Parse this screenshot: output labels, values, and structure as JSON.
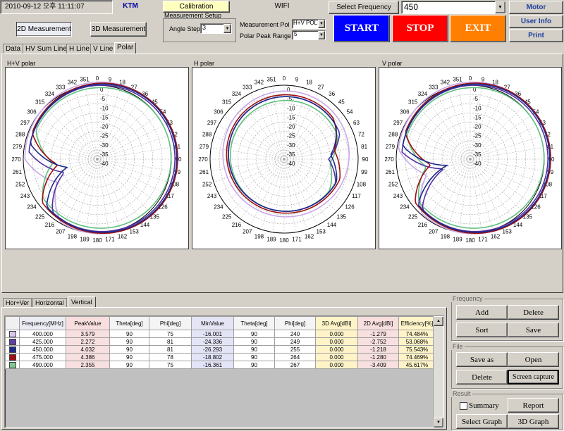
{
  "header": {
    "datetime": "2010-09-12 오후 11:11:07",
    "brand": "KTM",
    "calibration_label": "Calibration",
    "wifi_label": "WIFI",
    "select_frequency_label": "Select Frequency",
    "select_frequency_value": "450",
    "motor_label": "Motor",
    "user_info_label": "User Info",
    "print_label": "Print",
    "mode_2d_label": "2D Measurement",
    "mode_3d_label": "3D Measurement",
    "measurement_setup_label": "Measurement  Setup",
    "angle_step_label": "Angle Step",
    "angle_step_value": "3",
    "measurement_pol_label": "Measurement Pol",
    "measurement_pol_value": "H+V POL",
    "polar_peak_range_label": "Polar Peak Range",
    "polar_peak_range_value": "5",
    "start_label": "START",
    "stop_label": "STOP",
    "exit_label": "EXIT",
    "start_color": "#0000ff",
    "stop_color": "#ff0000",
    "exit_color": "#ff8000"
  },
  "tabs": [
    "Data",
    "HV Sum Line",
    "H Line",
    "V Line",
    "Polar"
  ],
  "active_tab": "Polar",
  "polar": {
    "plots": [
      {
        "title": "H+V polar"
      },
      {
        "title": "H polar"
      },
      {
        "title": "V polar"
      }
    ],
    "angle_labels": [
      "0",
      "9",
      "18",
      "27",
      "36",
      "45",
      "54",
      "63",
      "72",
      "81",
      "90",
      "99",
      "108",
      "117",
      "126",
      "135",
      "144",
      "153",
      "162",
      "171",
      "180",
      "189",
      "198",
      "207",
      "216",
      "225",
      "234",
      "243",
      "252",
      "261",
      "270",
      "279",
      "288",
      "297",
      "306",
      "315",
      "324",
      "333",
      "342",
      "351"
    ],
    "radial_labels": [
      "0",
      "-5",
      "-10",
      "-15",
      "-20",
      "-25",
      "-30",
      "-35",
      "-40"
    ]
  },
  "bottom_tabs": [
    "Hor+Ver",
    "Horizontal",
    "Vertical"
  ],
  "active_bottom_tab": "Vertical",
  "table": {
    "headers": [
      "",
      "Frequency[MHz]",
      "PeakValue",
      "Theta[deg]",
      "Phi[deg]",
      "MinValue",
      "Theta[deg]",
      "Phi[deg]",
      "3D Avg[dBi]",
      "2D Avg[dBi]",
      "Efficiency[%]"
    ],
    "rows": [
      {
        "color": "#d8c8f0",
        "cells": [
          "400.000",
          "3.579",
          "90",
          "75",
          "-16.001",
          "90",
          "240",
          "0.000",
          "-1.279",
          "74.484%"
        ]
      },
      {
        "color": "#6040a0",
        "cells": [
          "425.000",
          "2.272",
          "90",
          "81",
          "-24.336",
          "90",
          "249",
          "0.000",
          "-2.752",
          "53.068%"
        ]
      },
      {
        "color": "#1c2a8a",
        "cells": [
          "450.000",
          "4.032",
          "90",
          "81",
          "-26.293",
          "90",
          "255",
          "0.000",
          "-1.218",
          "75.543%"
        ]
      },
      {
        "color": "#a01010",
        "cells": [
          "475.000",
          "4.386",
          "90",
          "78",
          "-18.802",
          "90",
          "264",
          "0.000",
          "-1.280",
          "74.469%"
        ]
      },
      {
        "color": "#80c890",
        "cells": [
          "490.000",
          "2.355",
          "90",
          "75",
          "-16.361",
          "90",
          "267",
          "0.000",
          "-3.409",
          "45.617%"
        ]
      }
    ]
  },
  "side": {
    "frequency_group": "Frequency",
    "file_group": "File",
    "result_group": "Result",
    "add": "Add",
    "delete1": "Delete",
    "sort": "Sort",
    "save": "Save",
    "save_as": "Save as",
    "open": "Open",
    "delete2": "Delete",
    "screen_capture": "Screen capture",
    "summary": "Summary",
    "report": "Report",
    "select_graph": "Select Graph",
    "graph_3d": "3D Graph"
  },
  "series_colors": {
    "f400": "#c8a8e8",
    "f425": "#5030a0",
    "f450": "#1c2a8a",
    "f475": "#a01010",
    "f490": "#60c080"
  }
}
